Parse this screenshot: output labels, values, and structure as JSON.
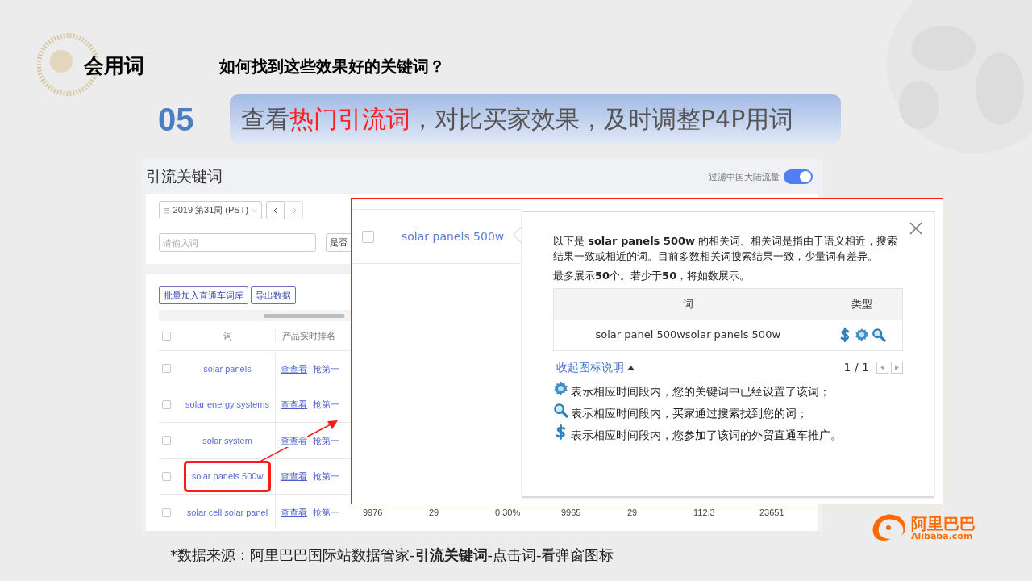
{
  "section_title": "会用词",
  "question": "如何找到这些效果好的关键词？",
  "step_number": "05",
  "banner": [
    {
      "text": "查看",
      "highlight": false
    },
    {
      "text": "热门引流词",
      "highlight": true
    },
    {
      "text": "，对比买家效果，及时调整P4P用词",
      "highlight": false
    }
  ],
  "panel": {
    "title": "引流关键词",
    "filter_label": "过滤中国大陆流量",
    "filter_on": true,
    "week": "2019 第31周 (PST)",
    "search_placeholder": "请输入词",
    "select_value": "是否",
    "select_all_checked": false,
    "buttons": [
      "批量加入直通车词库",
      "导出数据"
    ],
    "columns": [
      "词",
      "产品实时排名"
    ],
    "rows": [
      {
        "word": "solar panels",
        "view": "查查看",
        "grab": "抢第一",
        "checked": false,
        "highlighted": false,
        "values": []
      },
      {
        "word": "solar energy systems",
        "view": "查查看",
        "grab": "抢第一",
        "checked": false,
        "highlighted": false,
        "values": []
      },
      {
        "word": "solar system",
        "view": "查查看",
        "grab": "抢第一",
        "checked": false,
        "highlighted": false,
        "values": []
      },
      {
        "word": "solar panels 500w",
        "view": "查查看",
        "grab": "抢第一",
        "checked": false,
        "highlighted": true,
        "values": []
      },
      {
        "word": "solar cell solar panel",
        "view": "查查看",
        "grab": "抢第一",
        "checked": false,
        "highlighted": false,
        "values": [
          "9976",
          "29",
          "0.30%",
          "9965",
          "29",
          "112.3",
          "23651"
        ]
      }
    ]
  },
  "popup": {
    "word": "solar panels 500w",
    "checked": false,
    "intro": "以下是 **solar panels 500w** 的相关词。相关词是指由于语义相近，搜索结果一致或相近的词。目前多数相关词搜索结果一致，少量词有差异。",
    "limit": "最多展示**50**个。若少于**50**，将如数展示。",
    "table_columns": [
      "词",
      "类型"
    ],
    "table_rows": [
      {
        "word": "solar panel 500wsolar panels 500w"
      }
    ],
    "collapse_link": "收起图标说明",
    "pager": "1 / 1",
    "legend": [
      {
        "kind": "gear",
        "text": "表示相应时间段内，您的关键词中已经设置了该词；"
      },
      {
        "kind": "search",
        "text": "表示相应时间段内，买家通过搜索找到您的词；"
      },
      {
        "kind": "dollar",
        "text": "表示相应时间段内，您参加了该词的外贸直通车推广。"
      }
    ]
  },
  "caption": "*数据来源：阿里巴巴国际站数据管家-**引流关键词**-点击词-看弹窗图标",
  "logo": {
    "chinese": "阿里巴巴",
    "latin": "Alibaba.com"
  }
}
